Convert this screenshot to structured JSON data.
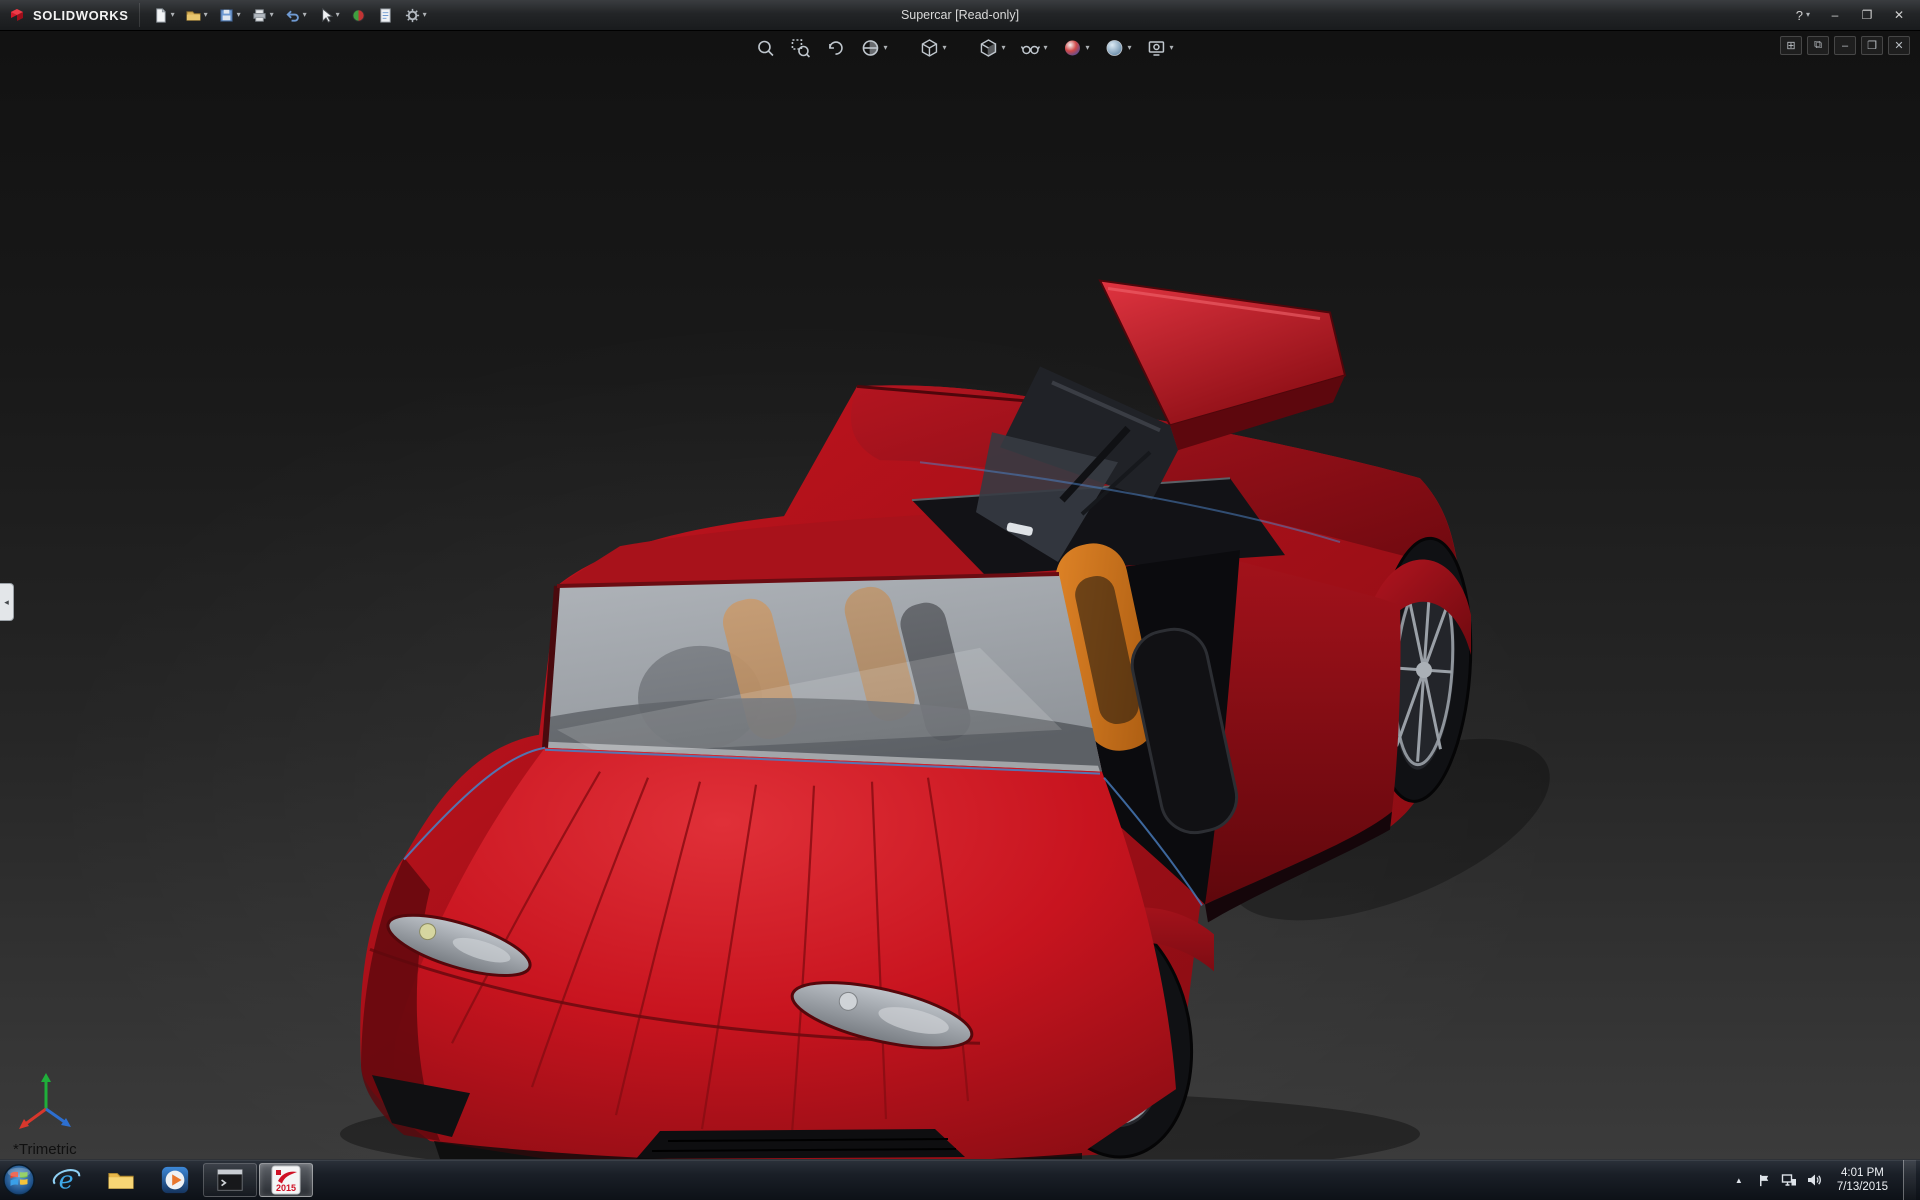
{
  "glyphs": {
    "caret": "▾"
  },
  "titlebar": {
    "app_name": "SOLIDWORKS",
    "title": "Supercar [Read-only]",
    "tools": [
      "new",
      "open",
      "save",
      "print",
      "undo",
      "select",
      "rebuild",
      "file-properties",
      "options"
    ],
    "help_glyph": "?",
    "minimize_glyph": "–",
    "maximize_glyph": "❐",
    "close_glyph": "✕"
  },
  "hud": {
    "tools": [
      "zoom-to-fit",
      "zoom-to-area",
      "previous-view",
      "section-view",
      "view-orientation",
      "display-style",
      "hide-show-items",
      "edit-appearance",
      "apply-scene",
      "view-settings"
    ]
  },
  "doc_controls": {
    "tile_glyph": "⊞",
    "cascade_glyph": "⧉",
    "minimize_glyph": "–",
    "restore_glyph": "❐",
    "close_glyph": "✕"
  },
  "viewport": {
    "view_label": "*Trimetric"
  },
  "panel": {
    "collapse_glyph": "◂"
  },
  "taskbar": {
    "apps": [
      "internet-explorer",
      "file-explorer",
      "media-player",
      "command-window",
      "solidworks-2015"
    ],
    "ie_glyph": "e",
    "sw_year": "2015",
    "tray_expand_glyph": "▲",
    "time": "4:01 PM",
    "date": "7/13/2015"
  },
  "colors": {
    "car_red": "#c8141f",
    "car_red_dark": "#7e0b11",
    "car_red_light": "#e03038",
    "seat_orange": "#e08427",
    "glass_gray": "#a8adb3",
    "edge_blue": "#4a7ec0",
    "viewport_top": "#121212",
    "viewport_bottom": "#3b3b3b"
  }
}
